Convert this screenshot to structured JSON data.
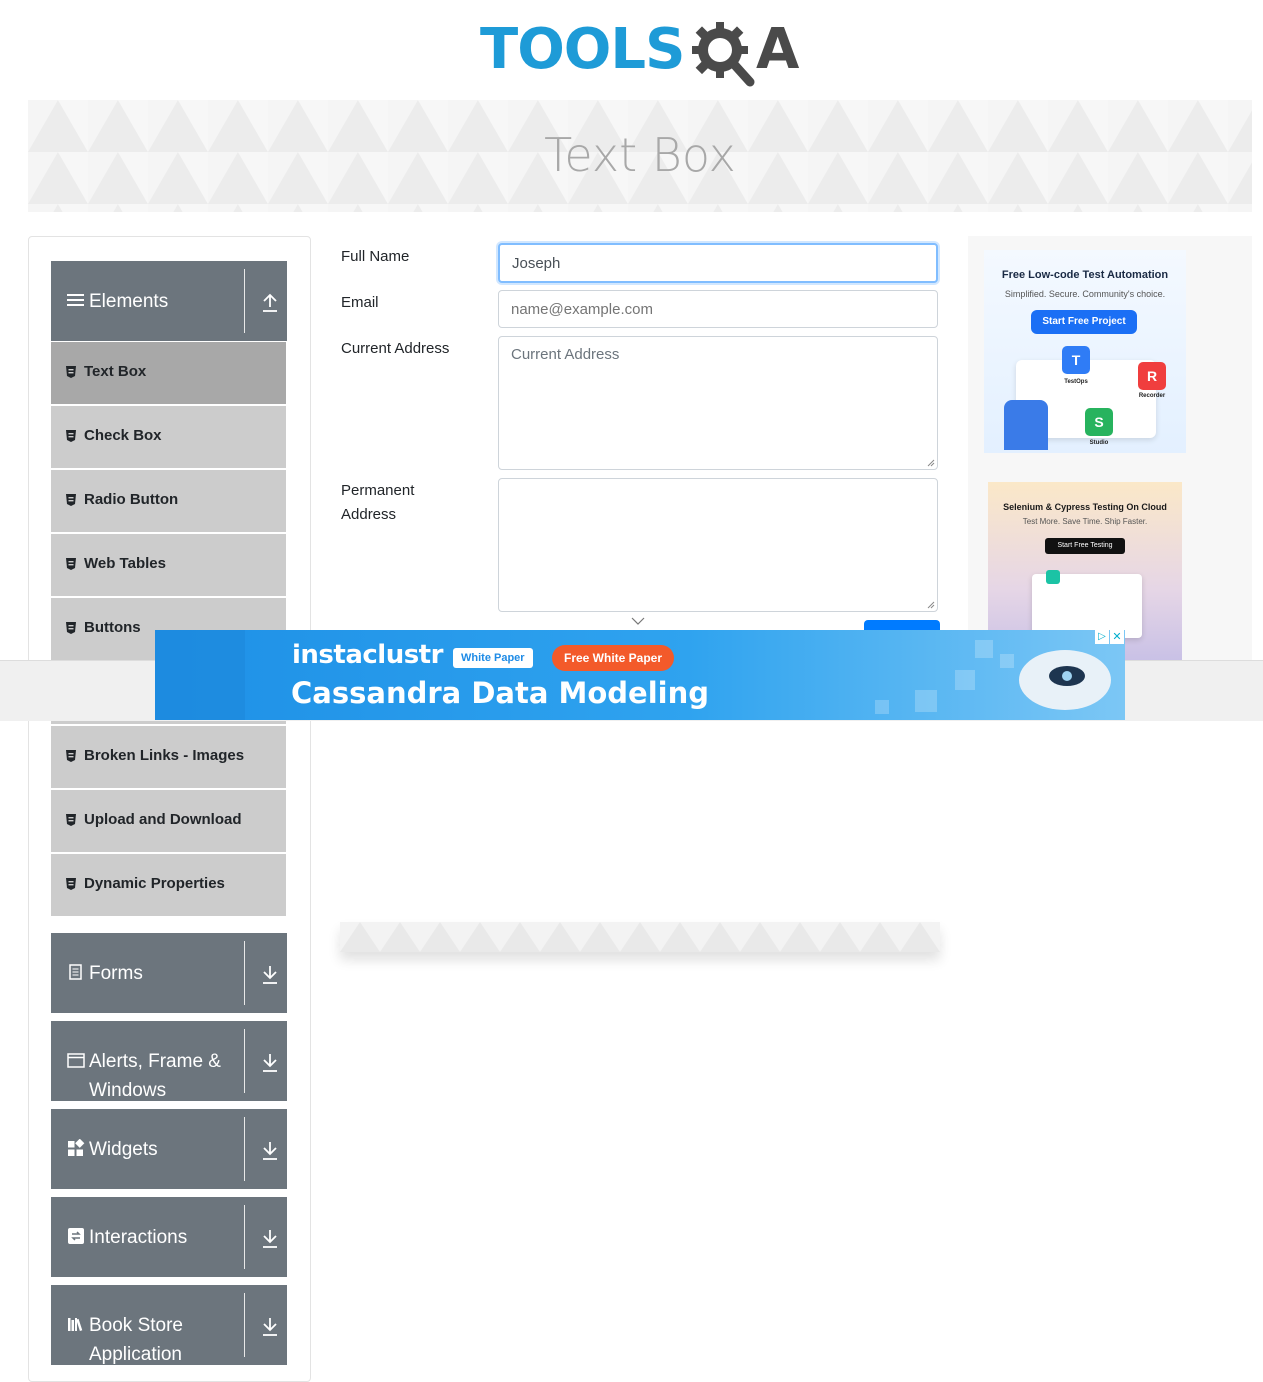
{
  "header": {
    "logo_text": "TOOLS",
    "logo_suffix": "A"
  },
  "banner": {
    "title": "Text Box"
  },
  "sidebar": {
    "elements_group": {
      "label": "Elements",
      "items": [
        {
          "label": "Text Box"
        },
        {
          "label": "Check Box"
        },
        {
          "label": "Radio Button"
        },
        {
          "label": "Web Tables"
        },
        {
          "label": "Buttons"
        },
        {
          "label": "Broken Links - Images"
        },
        {
          "label": "Upload and Download"
        },
        {
          "label": "Dynamic Properties"
        }
      ]
    },
    "groups": [
      {
        "label": "Forms"
      },
      {
        "label": "Alerts, Frame & Windows"
      },
      {
        "label": "Widgets"
      },
      {
        "label": "Interactions"
      },
      {
        "label": "Book Store Application"
      }
    ]
  },
  "form": {
    "full_name_label": "Full Name",
    "full_name_value": "Joseph",
    "email_label": "Email",
    "email_placeholder": "name@example.com",
    "current_address_label": "Current Address",
    "current_address_placeholder": "Current Address",
    "permanent_address_label": "Permanent Address"
  },
  "ads": {
    "ad1": {
      "title": "Free Low-code Test Automation",
      "subtitle": "Simplified. Secure. Community's choice.",
      "button": "Start Free Project",
      "label_testops": "TestOps",
      "label_recorder": "Recorder",
      "label_studio": "Studio"
    },
    "ad2": {
      "title": "Selenium & Cypress Testing On Cloud",
      "subtitle": "Test More. Save Time. Ship Faster.",
      "button": "Start Free Testing"
    },
    "banner_ad": {
      "brand": "instaclustr",
      "tag1": "White Paper",
      "tag2": "Free White Paper",
      "headline": "Cassandra Data Modeling"
    }
  },
  "colors": {
    "sidebar_header": "#6c757d",
    "sidebar_item": "#cccccc",
    "sidebar_item_active": "#a8a8a8",
    "logo_blue": "#1e9bd7",
    "focus_border": "#80bdff"
  }
}
